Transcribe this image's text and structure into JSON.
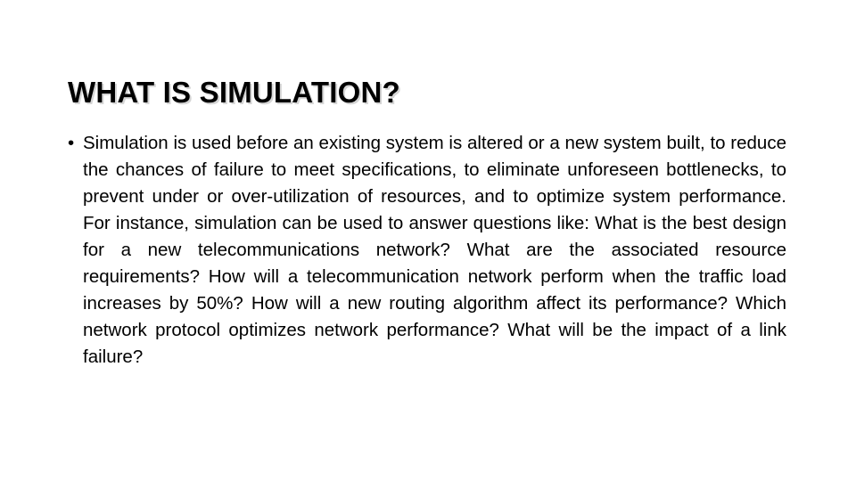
{
  "slide": {
    "title": "WHAT IS SIMULATION?",
    "background_color": "#ffffff",
    "title_color": "#000000",
    "title_shadow_color": "#d6d6d6",
    "body_color": "#000000",
    "bullets": [
      {
        "marker": "•",
        "text": "Simulation is used before an existing system is altered or a new system built, to reduce the chances of failure to meet specifications, to eliminate unforeseen bottlenecks, to prevent under or over-utilization of resources, and to optimize system performance. For instance, simulation can be used to answer questions like: What is the best design for a new telecommunications network? What are the associated resource requirements? How will a telecommunication network perform when the traffic load increases by 50%? How will a new routing algorithm affect its performance? Which network protocol optimizes network performance? What will be the impact of a link failure?"
      }
    ]
  }
}
